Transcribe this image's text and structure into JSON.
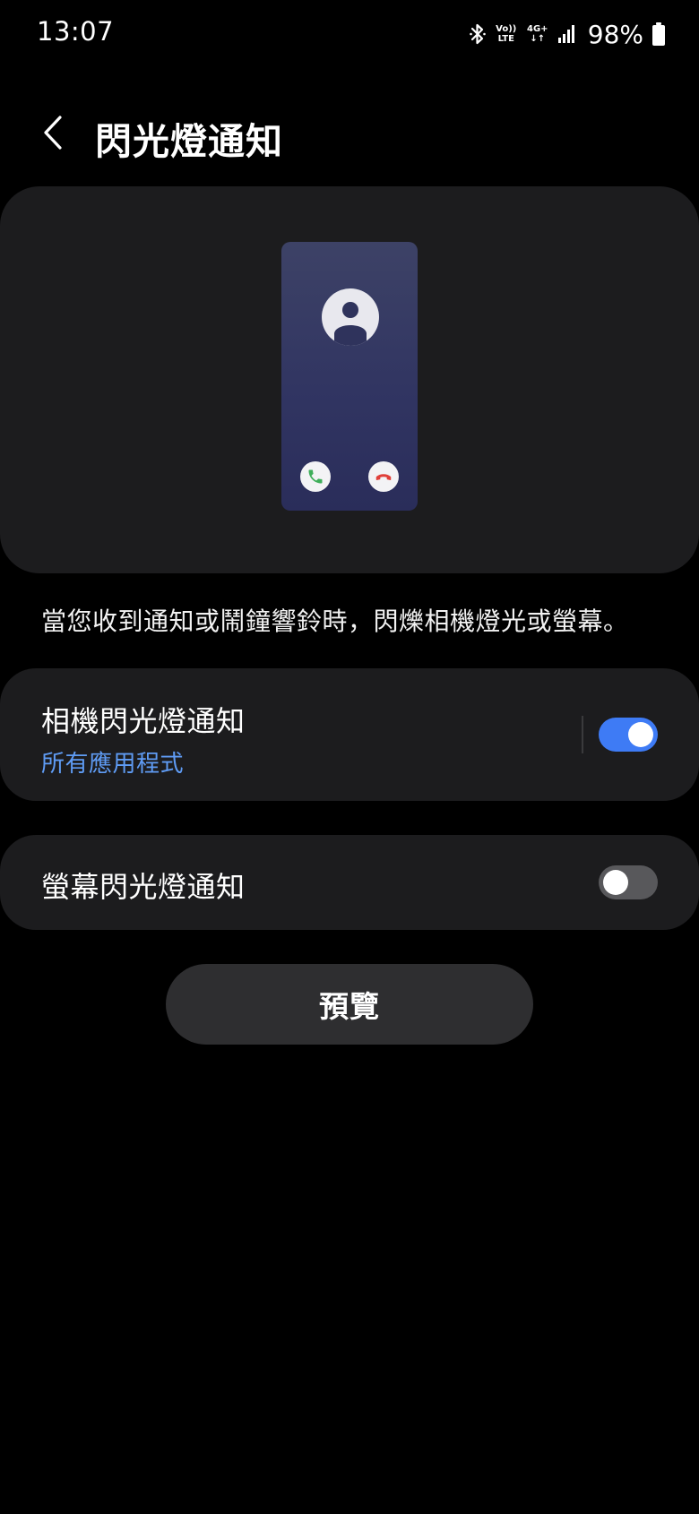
{
  "status_bar": {
    "time": "13:07",
    "volte_line1": "Vo))",
    "volte_line2": "LTE",
    "network_line1": "4G+",
    "network_line2": "↓↑",
    "battery_percent": "98%"
  },
  "header": {
    "title": "閃光燈通知"
  },
  "preview_illustration": {
    "accept_color": "#3fae5a",
    "decline_color": "#e0403a"
  },
  "description": "當您收到通知或鬧鐘響鈴時，閃爍相機燈光或螢幕。",
  "settings": {
    "camera_flash": {
      "title": "相機閃光燈通知",
      "subtitle": "所有應用程式",
      "enabled": true
    },
    "screen_flash": {
      "title": "螢幕閃光燈通知",
      "enabled": false
    }
  },
  "preview_button": {
    "label": "預覽"
  },
  "colors": {
    "background": "#000000",
    "card": "#1c1c1e",
    "accent": "#3e7bf5",
    "link": "#5f9cf5"
  }
}
